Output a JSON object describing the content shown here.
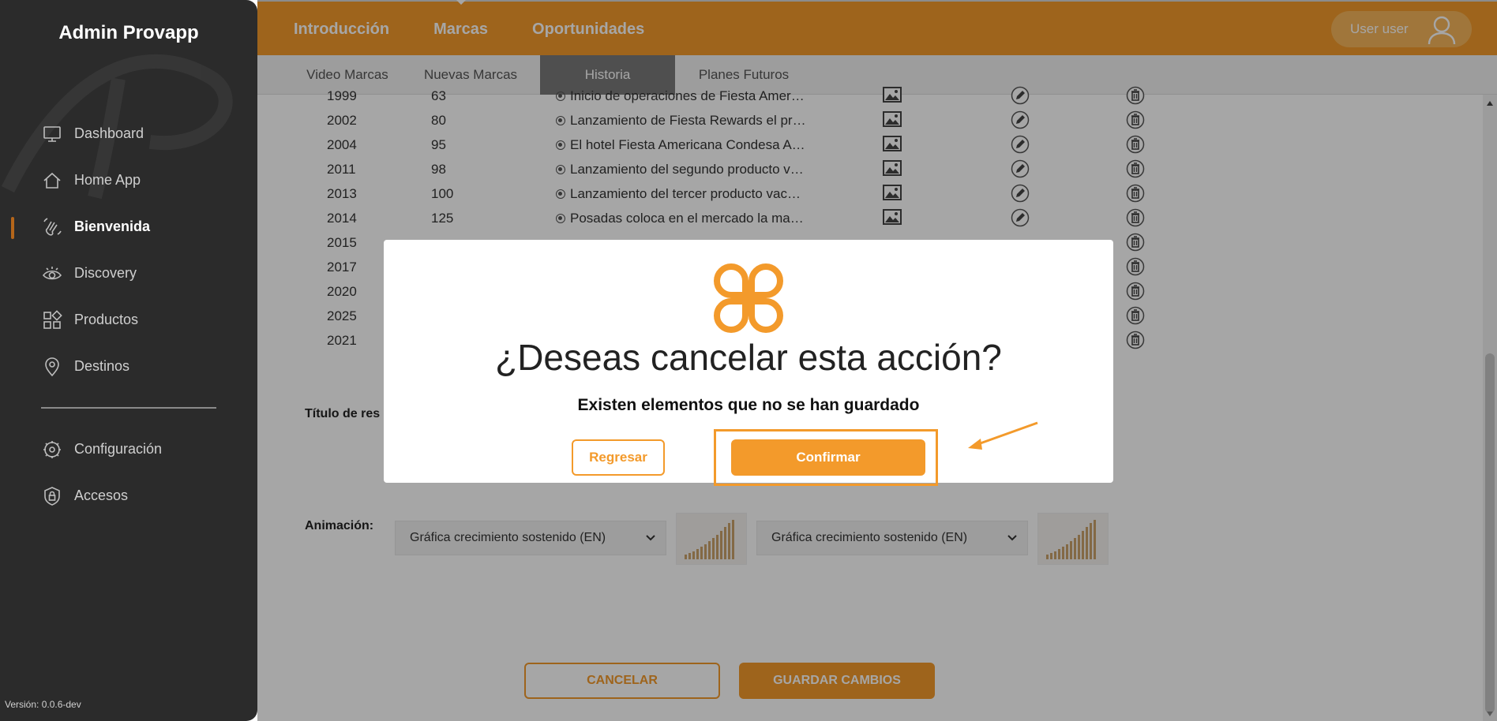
{
  "sidebar": {
    "brand": "Admin Provapp",
    "items": [
      {
        "label": "Dashboard",
        "icon": "monitor-icon"
      },
      {
        "label": "Home App",
        "icon": "home-icon"
      },
      {
        "label": "Bienvenida",
        "icon": "hand-wave-icon",
        "active": true
      },
      {
        "label": "Discovery",
        "icon": "eye-icon"
      },
      {
        "label": "Productos",
        "icon": "grid-icon"
      },
      {
        "label": "Destinos",
        "icon": "map-pin-icon"
      }
    ],
    "bottom_items": [
      {
        "label": "Configuración",
        "icon": "gear-icon"
      },
      {
        "label": "Accesos",
        "icon": "shield-lock-icon"
      }
    ],
    "version": "Versión: 0.0.6-dev"
  },
  "topbar": {
    "tabs": [
      "Introducción",
      "Marcas",
      "Oportunidades"
    ],
    "active_tab": "Marcas",
    "user_label": "User user"
  },
  "subnav": {
    "tabs": [
      "Video Marcas",
      "Nuevas Marcas",
      "Historia",
      "Planes Futuros"
    ],
    "active_tab": "Historia"
  },
  "history_rows": [
    {
      "year": "1999",
      "num": "63",
      "desc": "Inicio de operaciones de Fiesta Amer…"
    },
    {
      "year": "2002",
      "num": "80",
      "desc": "Lanzamiento de Fiesta Rewards el pr…"
    },
    {
      "year": "2004",
      "num": "95",
      "desc": "El hotel Fiesta Americana Condesa A…"
    },
    {
      "year": "2011",
      "num": "98",
      "desc": "Lanzamiento del segundo producto v…"
    },
    {
      "year": "2013",
      "num": "100",
      "desc": "Lanzamiento del tercer producto vac…"
    },
    {
      "year": "2014",
      "num": "125",
      "desc": "Posadas coloca en el mercado la ma…"
    },
    {
      "year": "2015",
      "num": "",
      "desc": ""
    },
    {
      "year": "2017",
      "num": "",
      "desc": ""
    },
    {
      "year": "2020",
      "num": "",
      "desc": ""
    },
    {
      "year": "2025",
      "num": "",
      "desc": ""
    },
    {
      "year": "2021",
      "num": "",
      "desc": ""
    }
  ],
  "form": {
    "titulo_label": "Título de res",
    "animacion_label": "Animación:",
    "select_es": "Gráfica crecimiento sostenido (EN)",
    "select_en": "Gráfica crecimiento sostenido (EN)"
  },
  "footer": {
    "cancel_label": "CANCELAR",
    "save_label": "GUARDAR CAMBIOS"
  },
  "modal": {
    "title": "¿Deseas cancelar esta acción?",
    "subtitle": "Existen elementos que no se han guardado",
    "back_label": "Regresar",
    "confirm_label": "Confirmar"
  },
  "colors": {
    "accent": "#f39a2b",
    "sidebar_bg": "#2b2b2b",
    "active_marker": "#b5661a"
  }
}
